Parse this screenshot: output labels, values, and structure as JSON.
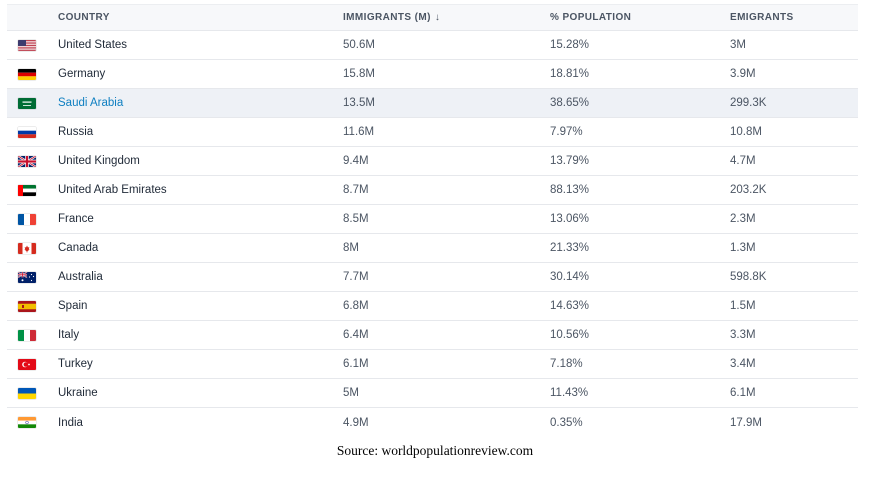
{
  "table": {
    "columns": {
      "country": "COUNTRY",
      "immigrants": "IMMIGRANTS (M)",
      "immigrants_sort": "↓",
      "percent": "% POPULATION",
      "emigrants": "EMIGRANTS"
    },
    "rows": [
      {
        "flag": "us-flag-icon",
        "country": "United States",
        "immigrants": "50.6M",
        "percent": "15.28%",
        "emigrants": "3M"
      },
      {
        "flag": "germany-flag-icon",
        "country": "Germany",
        "immigrants": "15.8M",
        "percent": "18.81%",
        "emigrants": "3.9M"
      },
      {
        "flag": "saudi-arabia-flag-icon",
        "country": "Saudi Arabia",
        "immigrants": "13.5M",
        "percent": "38.65%",
        "emigrants": "299.3K"
      },
      {
        "flag": "russia-flag-icon",
        "country": "Russia",
        "immigrants": "11.6M",
        "percent": "7.97%",
        "emigrants": "10.8M"
      },
      {
        "flag": "uk-flag-icon",
        "country": "United Kingdom",
        "immigrants": "9.4M",
        "percent": "13.79%",
        "emigrants": "4.7M"
      },
      {
        "flag": "uae-flag-icon",
        "country": "United Arab Emirates",
        "immigrants": "8.7M",
        "percent": "88.13%",
        "emigrants": "203.2K"
      },
      {
        "flag": "france-flag-icon",
        "country": "France",
        "immigrants": "8.5M",
        "percent": "13.06%",
        "emigrants": "2.3M"
      },
      {
        "flag": "canada-flag-icon",
        "country": "Canada",
        "immigrants": "8M",
        "percent": "21.33%",
        "emigrants": "1.3M"
      },
      {
        "flag": "australia-flag-icon",
        "country": "Australia",
        "immigrants": "7.7M",
        "percent": "30.14%",
        "emigrants": "598.8K"
      },
      {
        "flag": "spain-flag-icon",
        "country": "Spain",
        "immigrants": "6.8M",
        "percent": "14.63%",
        "emigrants": "1.5M"
      },
      {
        "flag": "italy-flag-icon",
        "country": "Italy",
        "immigrants": "6.4M",
        "percent": "10.56%",
        "emigrants": "3.3M"
      },
      {
        "flag": "turkey-flag-icon",
        "country": "Turkey",
        "immigrants": "6.1M",
        "percent": "7.18%",
        "emigrants": "3.4M"
      },
      {
        "flag": "ukraine-flag-icon",
        "country": "Ukraine",
        "immigrants": "5M",
        "percent": "11.43%",
        "emigrants": "6.1M"
      },
      {
        "flag": "india-flag-icon",
        "country": "India",
        "immigrants": "4.9M",
        "percent": "0.35%",
        "emigrants": "17.9M"
      }
    ],
    "highlight_color": "#eef1f6",
    "link_color": "#0e7fc1"
  },
  "caption": "Source: worldpopulationreview.com"
}
